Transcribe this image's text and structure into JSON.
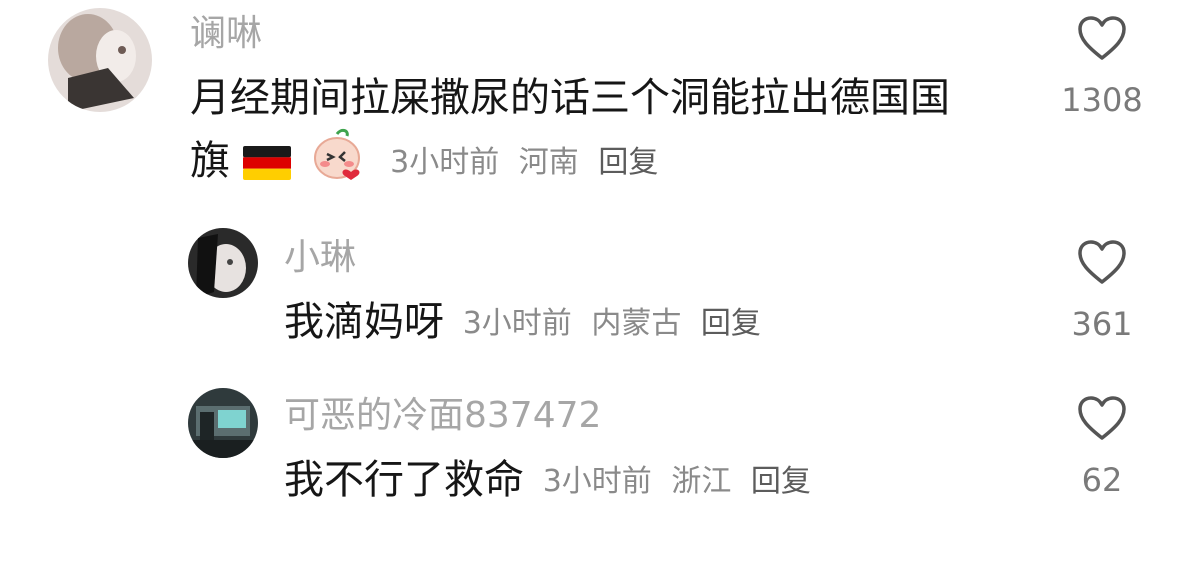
{
  "comments": [
    {
      "username": "谰啉",
      "text_line1": "月经期间拉屎撒尿的话三个洞能拉出德国国",
      "text_line2": "旗",
      "emojis": [
        "german-flag",
        "blushing-face-sticker"
      ],
      "time": "3小时前",
      "location": "河南",
      "reply_label": "回复",
      "likes": "1308"
    },
    {
      "username": "小琳",
      "text": "我滴妈呀",
      "time": "3小时前",
      "location": "内蒙古",
      "reply_label": "回复",
      "likes": "361"
    },
    {
      "username": "可恶的冷面837472",
      "text": "我不行了救命",
      "time": "3小时前",
      "location": "浙江",
      "reply_label": "回复",
      "likes": "62"
    }
  ],
  "colors": {
    "username": "#a6a6a6",
    "text": "#161616",
    "meta": "#8a8a8a",
    "like_icon": "#555555"
  },
  "icons": [
    "heart-outline-icon"
  ]
}
